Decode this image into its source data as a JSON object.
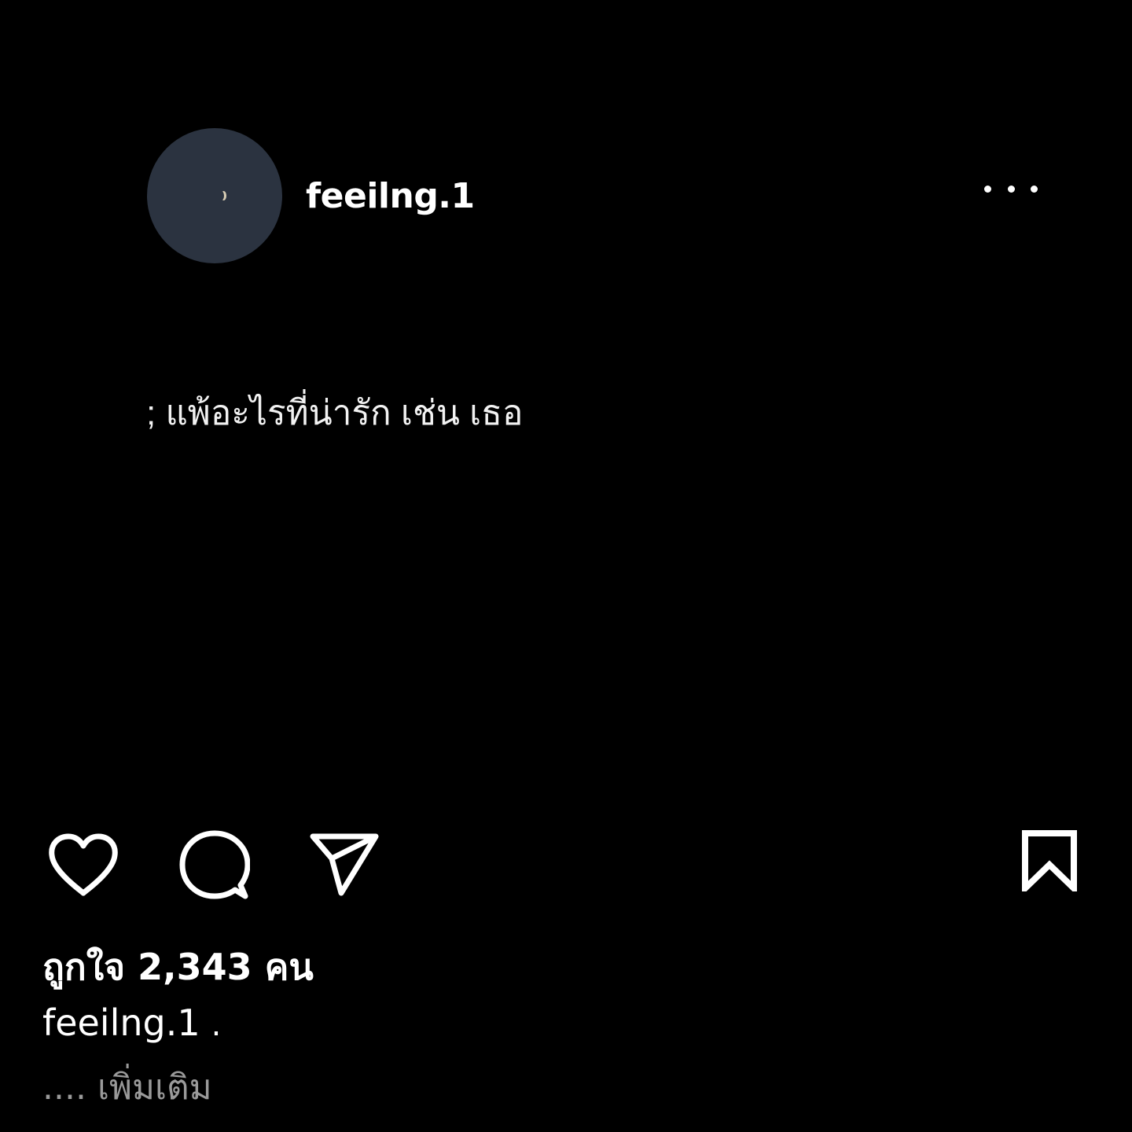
{
  "post_image": {
    "username": "feeilng.1",
    "quote": "; แพ้อะไรที่น่ารัก เช่น เธอ"
  },
  "actions": {
    "like_icon": "heart-outline-icon",
    "comment_icon": "speech-bubble-icon",
    "share_icon": "paper-plane-icon",
    "save_icon": "bookmark-icon"
  },
  "likes_text": "ถูกใจ 2,343 คน",
  "caption": {
    "username": "feeilng.1",
    "text": ".",
    "ellipsis": "....",
    "more_label": "เพิ่มเติม"
  },
  "colors": {
    "background": "#000000",
    "avatar": "#2b3340",
    "text": "#ffffff",
    "muted": "#9a9a9a"
  }
}
